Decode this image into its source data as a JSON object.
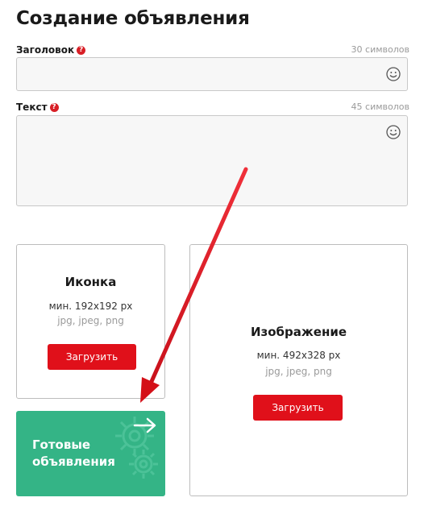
{
  "page": {
    "title": "Создание объявления"
  },
  "fields": {
    "headline": {
      "label": "Заголовок",
      "counter": "30 символов",
      "value": ""
    },
    "text": {
      "label": "Текст",
      "counter": "45 символов",
      "value": ""
    }
  },
  "icon_card": {
    "title": "Иконка",
    "size": "мин. 192x192 px",
    "formats": "jpg, jpeg, png",
    "button": "Загрузить"
  },
  "image_card": {
    "title": "Изображение",
    "size": "мин. 492x328 px",
    "formats": "jpg, jpeg, png",
    "button": "Загрузить"
  },
  "ready_tile": {
    "line1": "Готовые",
    "line2": "объявления"
  },
  "colors": {
    "accent_red": "#e0101a",
    "tile_green": "#34b486",
    "arrow_red": "#e0101a"
  },
  "icons": [
    "help-icon",
    "emoji-icon",
    "arrow-right-icon",
    "gear-icon"
  ]
}
